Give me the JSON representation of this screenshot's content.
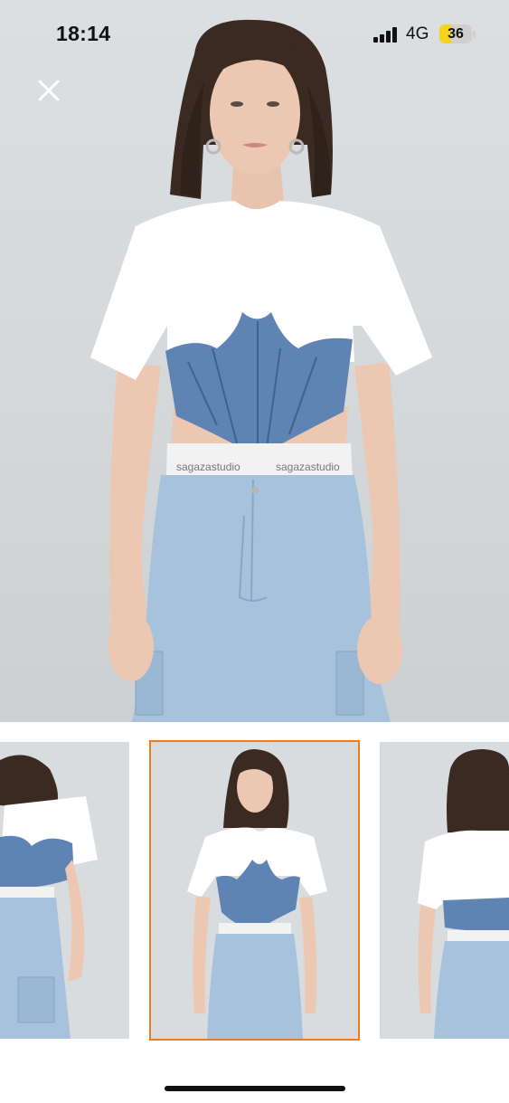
{
  "status_bar": {
    "time": "18:14",
    "network": "4G",
    "battery": "36"
  },
  "product": {
    "waistband_text": "sagazastudio"
  },
  "gallery": {
    "selected_index": 1,
    "accent_color": "#f27a1a"
  },
  "icons": {
    "close": "close-icon",
    "signal": "cellular-signal-icon",
    "battery": "battery-icon"
  }
}
